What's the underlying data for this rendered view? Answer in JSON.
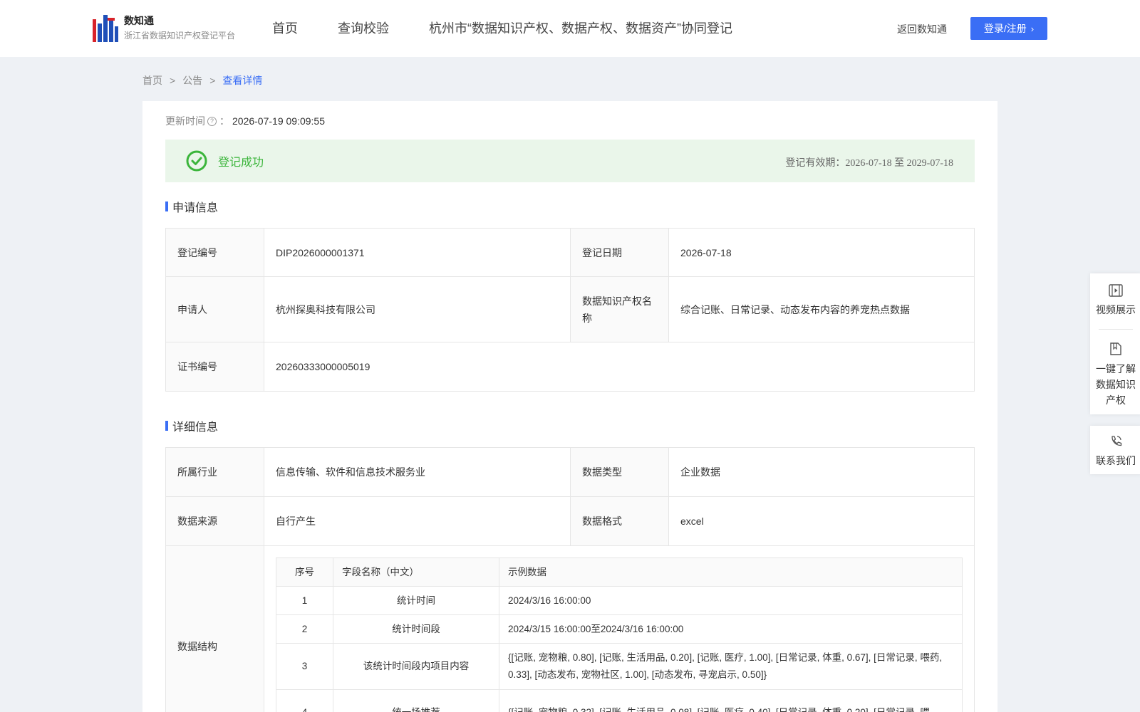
{
  "header": {
    "logo_title": "数知通",
    "logo_subtitle": "浙江省数据知识产权登记平台",
    "nav": [
      "首页",
      "查询校验",
      "杭州市“数据知识产权、数据产权、数据资产”协同登记"
    ],
    "back_link": "返回数知通",
    "login_label": "登录/注册"
  },
  "breadcrumb": {
    "home": "首页",
    "sep": ">",
    "notice": "公告",
    "current": "查看详情"
  },
  "update": {
    "label": "更新时间",
    "colon": "：",
    "value": "2026-07-19 09:09:55"
  },
  "status": {
    "text": "登记成功",
    "validity": "登记有效期：2026-07-18 至 2029-07-18",
    "color": "#3bb53b"
  },
  "application": {
    "title": "申请信息",
    "reg_no_label": "登记编号",
    "reg_no": "DIP2026000001371",
    "reg_date_label": "登记日期",
    "reg_date": "2026-07-18",
    "applicant_label": "申请人",
    "applicant": "杭州探奥科技有限公司",
    "ip_name_label": "数据知识产权名称",
    "ip_name": "综合记账、日常记录、动态发布内容的养宠热点数据",
    "cert_no_label": "证书编号",
    "cert_no": "20260333000005019"
  },
  "details": {
    "title": "详细信息",
    "industry_label": "所属行业",
    "industry": "信息传输、软件和信息技术服务业",
    "data_type_label": "数据类型",
    "data_type": "企业数据",
    "source_label": "数据来源",
    "source": "自行产生",
    "format_label": "数据格式",
    "format": "excel",
    "structure_label": "数据结构",
    "fields_header": [
      "序号",
      "字段名称（中文）",
      "示例数据"
    ],
    "fields": [
      {
        "no": "1",
        "name": "统计时间",
        "sample": "2024/3/16 16:00:00"
      },
      {
        "no": "2",
        "name": "统计时间段",
        "sample": "2024/3/15 16:00:00至2024/3/16 16:00:00"
      },
      {
        "no": "3",
        "name": "该统计时间段内项目内容",
        "sample": "{[记账, 宠物粮, 0.80], [记账, 生活用品, 0.20], [记账, 医疗, 1.00], [日常记录, 体重, 0.67], [日常记录, 喂药, 0.33], [动态发布, 宠物社区, 1.00], [动态发布, 寻宠启示, 0.50]}"
      },
      {
        "no": "4",
        "name": "统一场推荐",
        "sample": "{[记账, 宠物粮, 0.32], [记账, 生活用品, 0.08], [记账, 医疗, 0.40], [日常记录, 体重, 0.20], [日常记录, 喂"
      }
    ]
  },
  "side_panel": {
    "video": "视频展示",
    "learn": "一键了解数据知识产权",
    "contact": "联系我们"
  },
  "colors": {
    "accent": "#3a6ef5",
    "success_bg": "#eaf6ea"
  }
}
